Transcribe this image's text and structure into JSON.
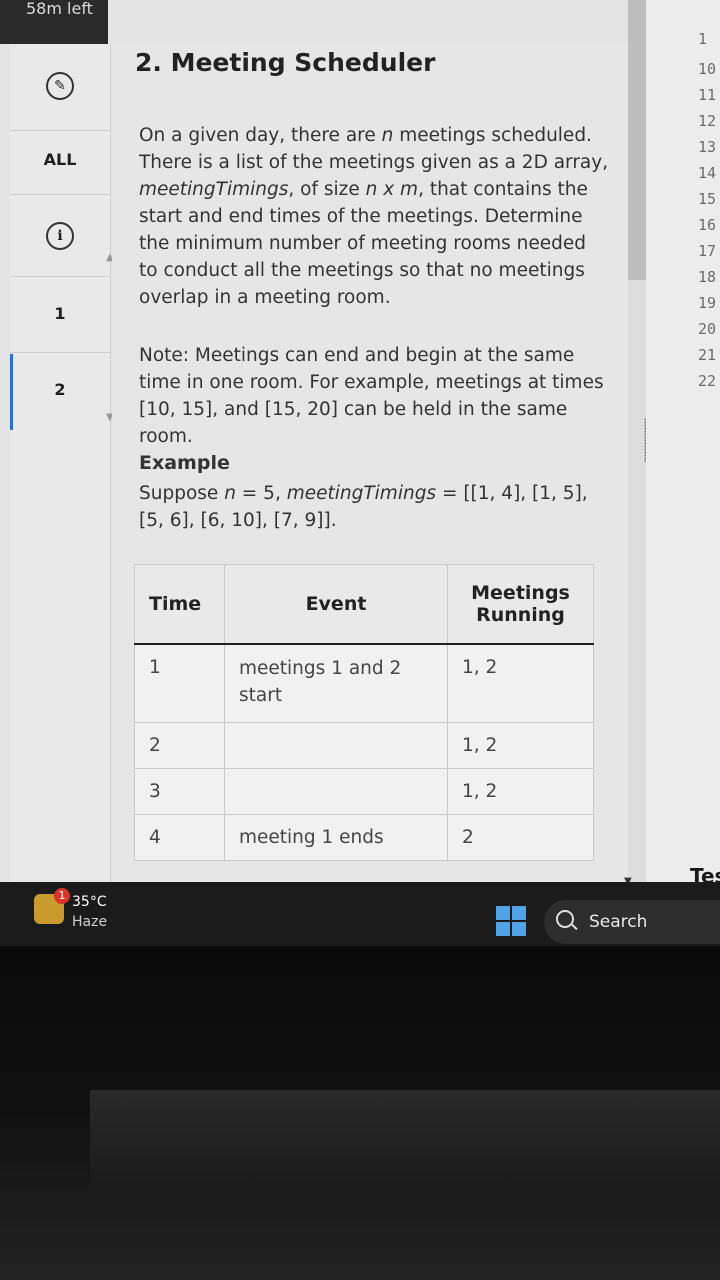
{
  "timer": {
    "label": "58m left"
  },
  "sidebar": {
    "all_label": "ALL",
    "items": [
      {
        "label": "1"
      },
      {
        "label": "2"
      }
    ],
    "icons": [
      "edit-icon",
      "info-icon"
    ]
  },
  "problem": {
    "title": "2. Meeting Scheduler",
    "p1_a": "On a given day, there are ",
    "p1_n": "n",
    "p1_b": " meetings scheduled. There is a list of the meetings given as a 2D array, ",
    "p1_var": "meetingTimings",
    "p1_c": ", of size ",
    "p1_size": "n x m",
    "p1_d": ", that contains the start and end times of the meetings. Determine the minimum number of meeting rooms needed to conduct all the meetings so that no meetings overlap in a meeting room.",
    "note": "Note: Meetings can end and begin at the same time in one room. For example, meetings at times [10, 15], and [15, 20] can be held in the same room.",
    "example_title": "Example",
    "ex_a": "Suppose ",
    "ex_n": "n",
    "ex_b": " = 5, ",
    "ex_var": "meetingTimings",
    "ex_c": " = [[1, 4], [1, 5], [5, 6], [6, 10], [7, 9]]."
  },
  "table": {
    "headers": {
      "time": "Time",
      "event": "Event",
      "running": "Meetings Running"
    },
    "rows": [
      {
        "time": "1",
        "event": "meetings 1 and 2 start",
        "running": "1, 2"
      },
      {
        "time": "2",
        "event": "",
        "running": "1, 2"
      },
      {
        "time": "3",
        "event": "",
        "running": "1, 2"
      },
      {
        "time": "4",
        "event": "meeting 1 ends",
        "running": "2"
      }
    ]
  },
  "editor": {
    "line_numbers": [
      "1",
      "10",
      "11",
      "12",
      "13",
      "14",
      "15",
      "16",
      "17",
      "18",
      "19",
      "20",
      "21",
      "22"
    ],
    "test_label": "Tes"
  },
  "taskbar": {
    "weather_badge": "1",
    "temperature": "35°C",
    "condition": "Haze",
    "search_label": "Search"
  },
  "colors": {
    "accent": "#2b6fd6",
    "taskbar": "#1b1b1b"
  }
}
